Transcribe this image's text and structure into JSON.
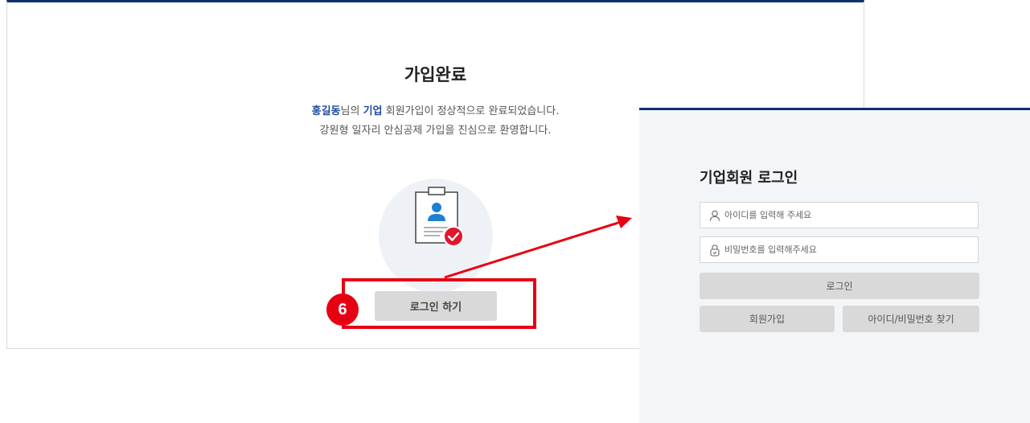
{
  "complete": {
    "title": "가입완료",
    "msg_name": "홍길동",
    "msg_part1": "님의 ",
    "msg_type": "기업",
    "msg_part2": " 회원가입이 정상적으로 완료되었습니다.",
    "msg_line2": "강원형 일자리 안심공제 가입을 진심으로 환영합니다.",
    "login_button": "로그인 하기"
  },
  "annotation": {
    "step_number": "6",
    "color": "#e60012"
  },
  "login": {
    "title": "기업회원 로그인",
    "id_placeholder": "아이디를 입력해 주세요",
    "pw_placeholder": "비밀번호를 입력해주세요",
    "login_button": "로그인",
    "signup_button": "회원가입",
    "find_button": "아이디/비밀번호 찾기"
  },
  "icons": {
    "clipboard": "clipboard-user-icon",
    "check": "check-circle-icon",
    "user": "user-icon",
    "lock": "lock-icon"
  },
  "colors": {
    "brand_navy": "#0f3170",
    "highlight_blue": "#1f4b9c",
    "button_gray": "#d9d9d9",
    "panel_bg": "#f3f6f9"
  }
}
